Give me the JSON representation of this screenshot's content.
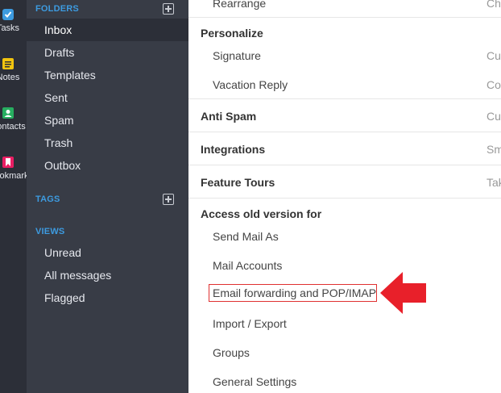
{
  "rail": {
    "items": [
      {
        "label": "Tasks",
        "icon": "tasks-icon"
      },
      {
        "label": "Notes",
        "icon": "notes-icon"
      },
      {
        "label": "Contacts",
        "icon": "contacts-icon"
      },
      {
        "label": "Bookmarks",
        "icon": "bookmarks-icon"
      }
    ]
  },
  "sidebar": {
    "folders_header": "FOLDERS",
    "folders": [
      "Inbox",
      "Drafts",
      "Templates",
      "Sent",
      "Spam",
      "Trash",
      "Outbox"
    ],
    "active_folder": "Inbox",
    "tags_header": "TAGS",
    "views_header": "VIEWS",
    "views": [
      "Unread",
      "All messages",
      "Flagged"
    ]
  },
  "settings": {
    "rearrange": "Rearrange",
    "rearrange_right": "Ch",
    "personalize": "Personalize",
    "signature": "Signature",
    "signature_right": "Cu",
    "vacation_reply": "Vacation Reply",
    "vacation_right": "Co",
    "anti_spam": "Anti Spam",
    "anti_spam_right": "Cu",
    "integrations": "Integrations",
    "integrations_right": "Sm",
    "feature_tours": "Feature Tours",
    "feature_tours_right": "Tak",
    "access_old": "Access old version for",
    "send_mail_as": "Send Mail As",
    "mail_accounts": "Mail Accounts",
    "email_forwarding": "Email forwarding and POP/IMAP",
    "import_export": "Import / Export",
    "groups": "Groups",
    "general_settings": "General Settings"
  },
  "colors": {
    "rail_bg": "#2c2f38",
    "sidebar_bg": "#383c46",
    "accent": "#3d9be0",
    "highlight": "#e03131",
    "arrow": "#e8202a"
  }
}
